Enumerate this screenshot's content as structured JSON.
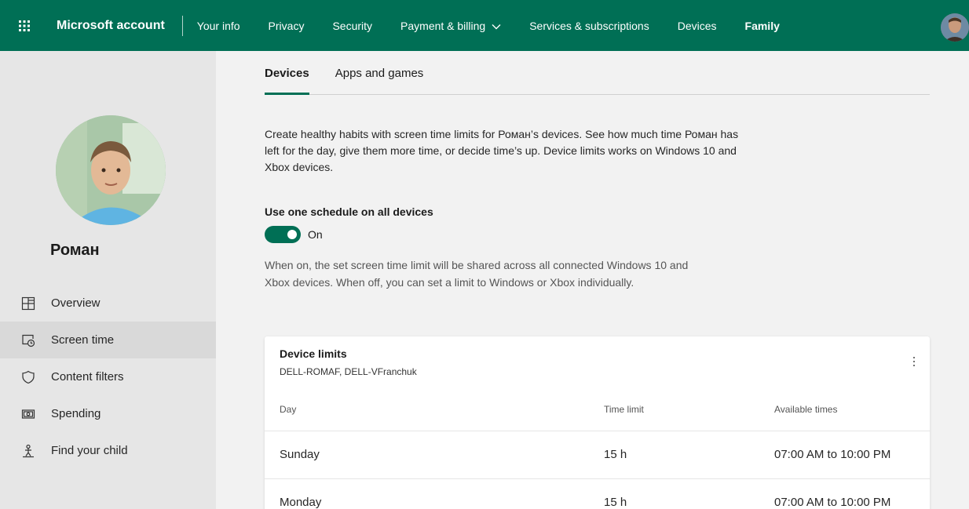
{
  "app": {
    "brand": "Microsoft account",
    "accent": "#006f55"
  },
  "topnav": {
    "items": [
      {
        "label": "Your info"
      },
      {
        "label": "Privacy"
      },
      {
        "label": "Security"
      },
      {
        "label": "Payment & billing"
      },
      {
        "label": "Services & subscriptions"
      },
      {
        "label": "Devices"
      },
      {
        "label": "Family"
      }
    ],
    "active": "Family"
  },
  "sidebar": {
    "child_name": "Роман",
    "items": [
      {
        "label": "Overview",
        "icon": "overview-icon"
      },
      {
        "label": "Screen time",
        "icon": "screen-time-icon",
        "active": true
      },
      {
        "label": "Content filters",
        "icon": "shield-icon"
      },
      {
        "label": "Spending",
        "icon": "money-icon"
      },
      {
        "label": "Find your child",
        "icon": "find-child-icon"
      }
    ]
  },
  "main": {
    "tabs": [
      {
        "label": "Devices",
        "active": true
      },
      {
        "label": "Apps and games"
      }
    ],
    "intro": "Create healthy habits with screen time limits for Роман’s devices. See how much time Роман has left for the day, give them more time, or decide time’s up. Device limits works on Windows 10 and Xbox devices.",
    "schedule_label": "Use one schedule on all devices",
    "toggle_state": "On",
    "note": "When on, the set screen time limit will be shared across all connected Windows 10 and Xbox devices. When off, you can set a limit to Windows or Xbox individually."
  },
  "device_limits": {
    "title": "Device limits",
    "subtitle": "DELL-ROMAF, DELL-VFranchuk",
    "columns": [
      "Day",
      "Time limit",
      "Available times"
    ],
    "rows": [
      {
        "day": "Sunday",
        "limit": "15 h",
        "available": "07:00 AM to 10:00 PM"
      },
      {
        "day": "Monday",
        "limit": "15 h",
        "available": "07:00 AM to 10:00 PM"
      }
    ]
  }
}
